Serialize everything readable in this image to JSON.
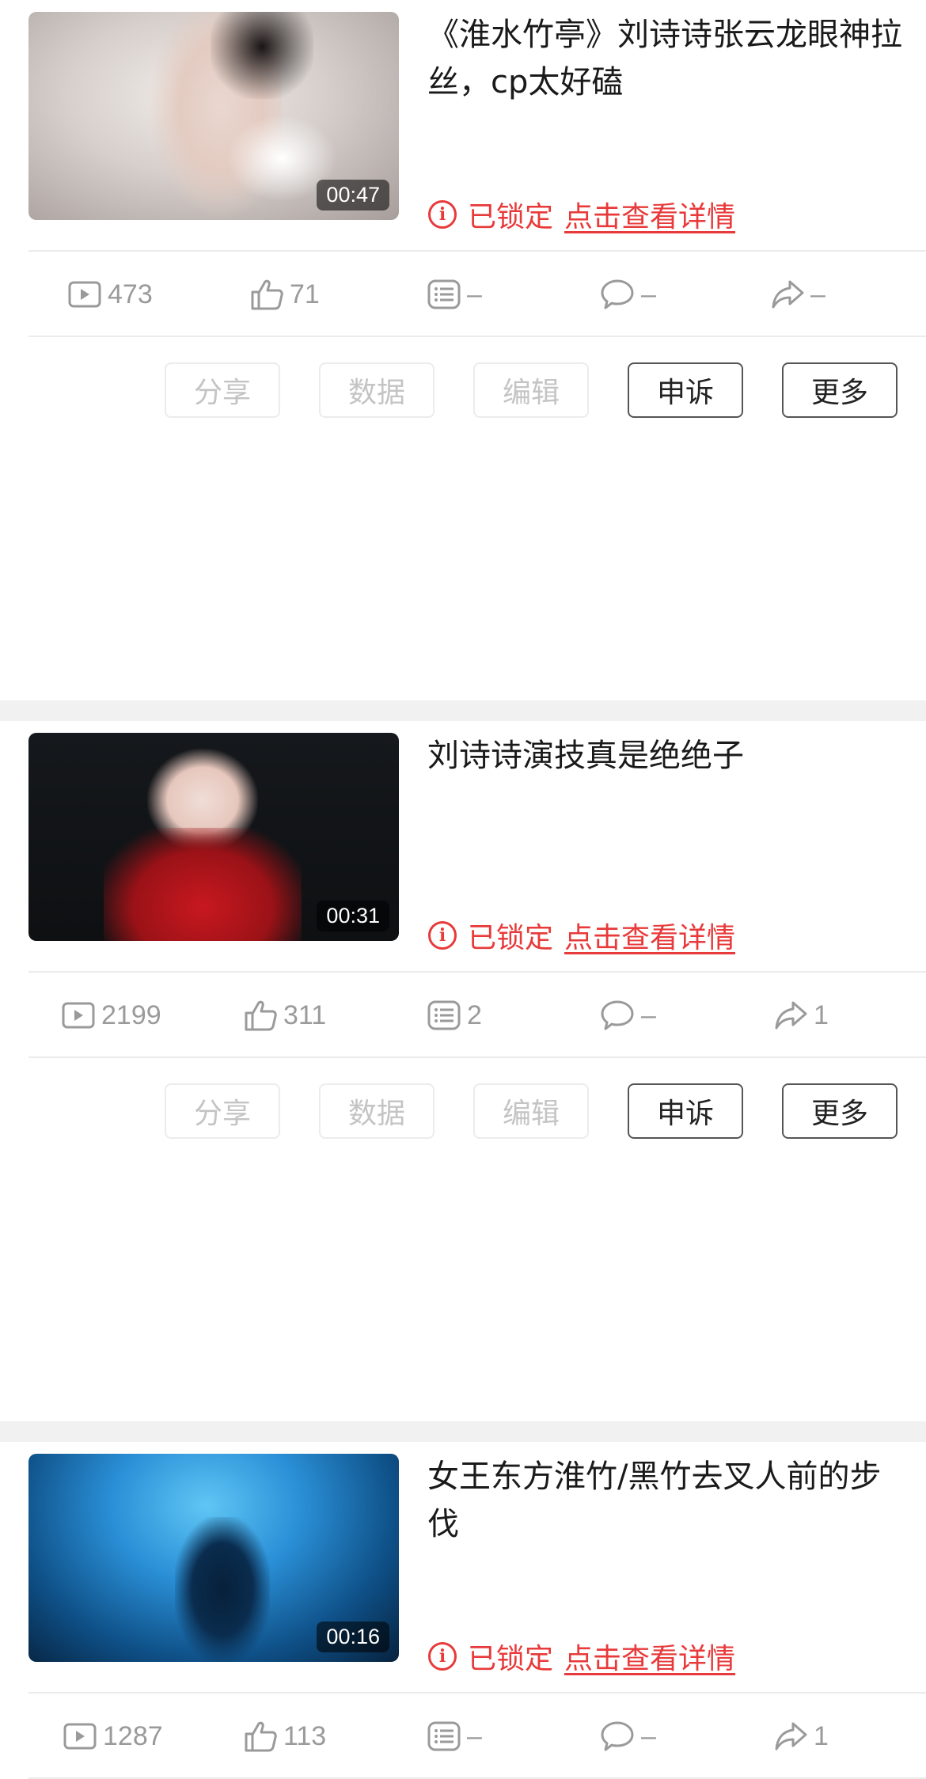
{
  "videos": [
    {
      "title": "《淮水竹亭》刘诗诗张云龙眼神拉丝，cp太好磕",
      "duration": "00:47",
      "status": "已锁定",
      "status_link": "点击查看详情",
      "stats": {
        "plays": "473",
        "likes": "71",
        "danmaku": "–",
        "comments": "–",
        "shares": "–"
      },
      "thumb_colors": [
        "#d9d4d2",
        "#bdb5b2"
      ]
    },
    {
      "title": "刘诗诗演技真是绝绝子",
      "duration": "00:31",
      "status": "已锁定",
      "status_link": "点击查看详情",
      "stats": {
        "plays": "2199",
        "likes": "311",
        "danmaku": "2",
        "comments": "–",
        "shares": "1"
      },
      "thumb_colors": [
        "#111418",
        "#b51a1f"
      ]
    },
    {
      "title": "女王东方淮竹/黑竹去叉人前的步伐",
      "duration": "00:16",
      "status": "已锁定",
      "status_link": "点击查看详情",
      "stats": {
        "plays": "1287",
        "likes": "113",
        "danmaku": "–",
        "comments": "–",
        "shares": "1"
      },
      "thumb_colors": [
        "#0a2a4a",
        "#2a8fd6"
      ]
    }
  ],
  "buttons": {
    "share": "分享",
    "data": "数据",
    "edit": "编辑",
    "appeal": "申诉",
    "more": "更多"
  },
  "icons": {
    "play": "play-count-icon",
    "like": "thumbs-up-icon",
    "danmaku": "danmaku-icon",
    "comment": "comment-icon",
    "share": "share-arrow-icon",
    "lock": "info-icon"
  },
  "colors": {
    "locked": "#e83a3a",
    "muted": "#9a9a9a"
  }
}
